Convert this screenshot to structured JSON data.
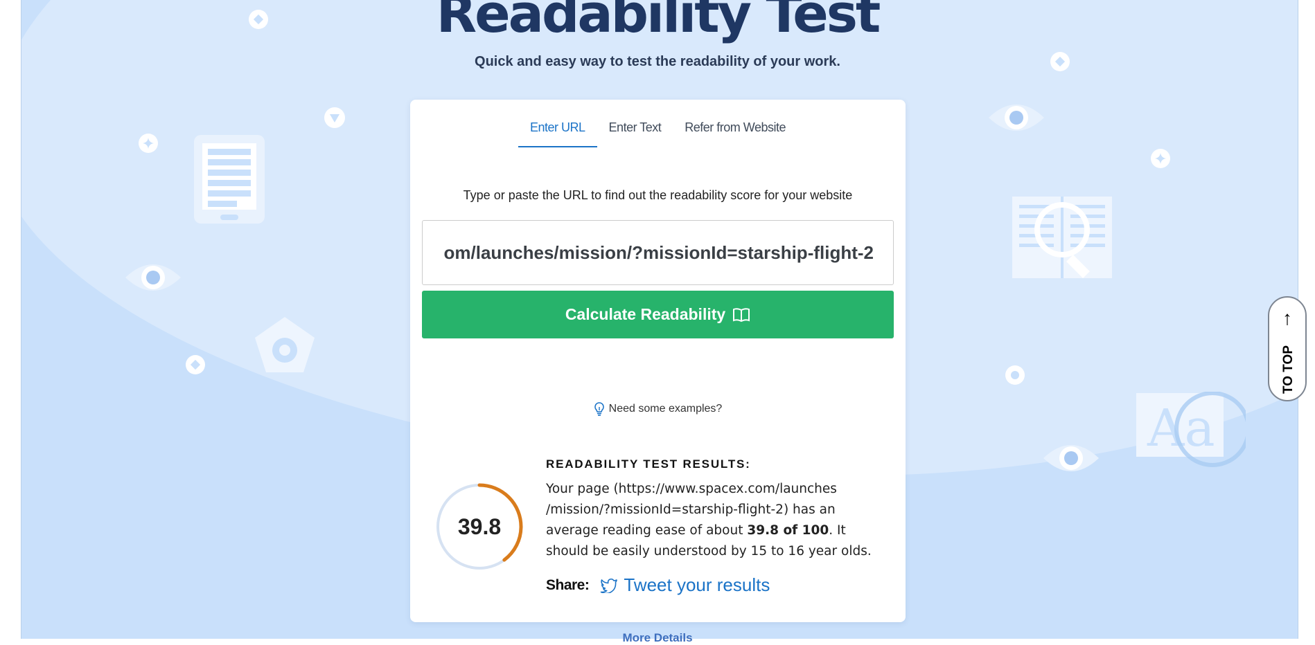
{
  "header": {
    "title": "Readability Test",
    "subtitle": "Quick and easy way to test the readability of your work."
  },
  "tabs": [
    {
      "label": "Enter URL",
      "active": true
    },
    {
      "label": "Enter Text",
      "active": false
    },
    {
      "label": "Refer from Website",
      "active": false
    }
  ],
  "form": {
    "instruction": "Type or paste the URL to find out the readability score for your website",
    "url_value": "om/launches/mission/?missionId=starship-flight-2",
    "button_label": "Calculate Readability",
    "button_icon": "open-book-icon",
    "examples_label": "Need some examples?",
    "examples_icon": "lightbulb-icon"
  },
  "results": {
    "heading": "READABILITY TEST RESULTS:",
    "score": "39.8",
    "score_fraction": 0.398,
    "text_before": "Your page (https://www.spacex.com/launches /mission/?missionId=starship-flight-2) has an average reading ease of about ",
    "score_bold": "39.8 of 100",
    "text_after": ". It should be easily understood by 15 to 16 year olds.",
    "share_label": "Share:",
    "tweet_label": "Tweet your results",
    "tweet_icon": "twitter-bird-icon"
  },
  "footer": {
    "more_details": "More Details"
  },
  "to_top": {
    "label": "TO TOP",
    "icon": "arrow-up-icon"
  },
  "colors": {
    "background": "#c9e0fb",
    "title": "#1f3763",
    "accent": "#1b73c7",
    "button": "#27b36b",
    "gauge_arc": "#d97c1c",
    "gauge_track": "#d6e2f2"
  }
}
